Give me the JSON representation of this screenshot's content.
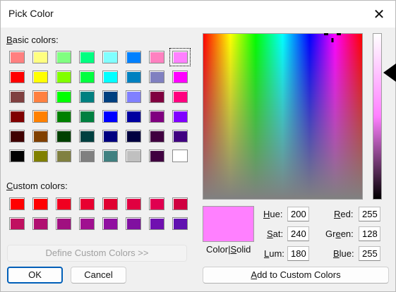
{
  "window": {
    "title": "Pick Color",
    "close_glyph": "✕"
  },
  "basic": {
    "label_hotkey": "B",
    "label_rest": "asic colors:",
    "rows": [
      [
        "#ff8080",
        "#ffff80",
        "#80ff80",
        "#00ff80",
        "#80ffff",
        "#0080ff",
        "#ff80c0",
        "#ff80ff"
      ],
      [
        "#ff0000",
        "#ffff00",
        "#80ff00",
        "#00ff40",
        "#00ffff",
        "#0080c0",
        "#8080c0",
        "#ff00ff"
      ],
      [
        "#804040",
        "#ff8040",
        "#00ff00",
        "#008080",
        "#004080",
        "#8080ff",
        "#800040",
        "#ff0080"
      ],
      [
        "#800000",
        "#ff8000",
        "#008000",
        "#008040",
        "#0000ff",
        "#0000a0",
        "#800080",
        "#8000ff"
      ],
      [
        "#400000",
        "#804000",
        "#004000",
        "#004040",
        "#000080",
        "#000040",
        "#400040",
        "#400080"
      ],
      [
        "#000000",
        "#808000",
        "#808040",
        "#808080",
        "#408080",
        "#c0c0c0",
        "#400040",
        "#ffffff"
      ]
    ],
    "selected_row": 0,
    "selected_col": 7
  },
  "custom": {
    "label_hotkey": "C",
    "label_rest": "ustom colors:",
    "rows": [
      [
        "#ff0000",
        "#ff0000",
        "#f00020",
        "#e80030",
        "#e00030",
        "#e00040",
        "#e00050",
        "#d00040"
      ],
      [
        "#c01060",
        "#b01070",
        "#a01080",
        "#a01090",
        "#9010a0",
        "#8010a0",
        "#7010b0",
        "#6010b0"
      ]
    ]
  },
  "buttons": {
    "define": "Define Custom Colors >>",
    "ok": "OK",
    "cancel": "Cancel",
    "add_hotkey": "A",
    "add_rest": "dd to Custom Colors"
  },
  "preview": {
    "color": "#ff80ff",
    "label_a": "Color|",
    "label_hotkey": "S",
    "label_b": "olid"
  },
  "hsl": [
    {
      "hotkey": "H",
      "rest": "ue:",
      "value": "200"
    },
    {
      "hotkey": "S",
      "rest": "at:",
      "value": "240"
    },
    {
      "hotkey": "L",
      "rest": "um:",
      "value": "180"
    }
  ],
  "rgb": [
    {
      "hotkey": "R",
      "rest": "ed:",
      "value": "255"
    },
    {
      "prefix": "Gr",
      "hotkey": "e",
      "rest": "en:",
      "value": "128"
    },
    {
      "hotkey": "B",
      "rest": "lue:",
      "value": "255"
    }
  ]
}
